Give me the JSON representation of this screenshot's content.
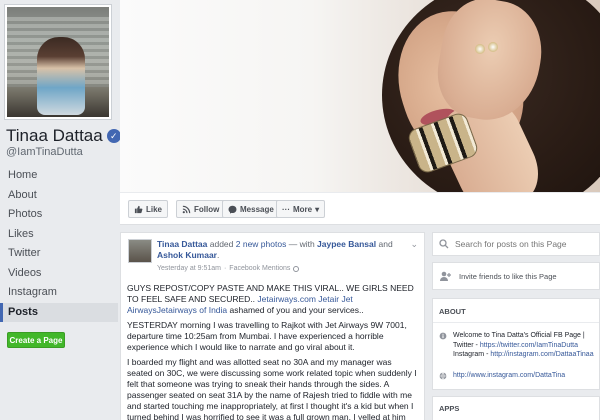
{
  "profile": {
    "name": "Tinaa Dattaa",
    "handle": "@IamTinaDutta"
  },
  "nav": {
    "items": [
      "Home",
      "About",
      "Photos",
      "Likes",
      "Twitter",
      "Videos",
      "Instagram",
      "Posts"
    ],
    "active": "Posts",
    "create_page": "Create a Page"
  },
  "actions": {
    "like": "Like",
    "follow": "Follow",
    "message": "Message",
    "more": "More"
  },
  "post": {
    "author": "Tinaa Dattaa",
    "added": " added ",
    "photos_link": "2 new photos",
    "with": " — with ",
    "tag1": "Jaypee Bansal",
    "and": " and ",
    "tag2": "Ashok Kumaar",
    "period": ".",
    "time": "Yesterday at 9:51am",
    "sep": "·",
    "source": "Facebook Mentions",
    "para1_a": "GUYS REPOST/COPY PASTE AND MAKE THIS VIRAL.. WE GIRLS NEED TO FEEL SAFE AND SECURED.. ",
    "para1_link": "Jetairways.com Jetair Jet AirwaysJetairways of India",
    "para1_b": " ashamed of you and your services..",
    "para2": "YESTERDAY morning I was travelling to Rajkot with Jet Airways 9W 7001, departure time 10:25am from Mumbai. I have experienced a horrible experience which I would like to narrate and go viral about it.",
    "para3": "I boarded my flight and was allotted seat no 30A and my manager was seated on 30C, we were discussing some work related topic when suddenly I felt that someone was trying to sneak their hands through the sides. A passenger seated on seat 31A by the name of Rajesh tried to fiddle with me and started touching me inappropriately, at first I thought it's a kid but when I turned behind I was horrified to see it was a full grown man, I yelled at him"
  },
  "sidebar_right": {
    "search_placeholder": "Search for posts on this Page",
    "invite": "Invite friends to like this Page",
    "about_title": "ABOUT",
    "about_text_a": "Welcome to Tina Datta's Official FB Page | Twitter - ",
    "about_link_twitter": "https://twitter.com/IamTinaDutta",
    "about_text_b": " Instagram - ",
    "about_link_insta": "http://instagram.com/DattaaTinaa",
    "about_website": "http://www.instagram.com/DattaTina",
    "apps_title": "APPS"
  },
  "colors": {
    "facebook_blue": "#4267b2",
    "link_blue": "#365899",
    "create_green": "#42b72a",
    "background": "#e9ebee"
  }
}
